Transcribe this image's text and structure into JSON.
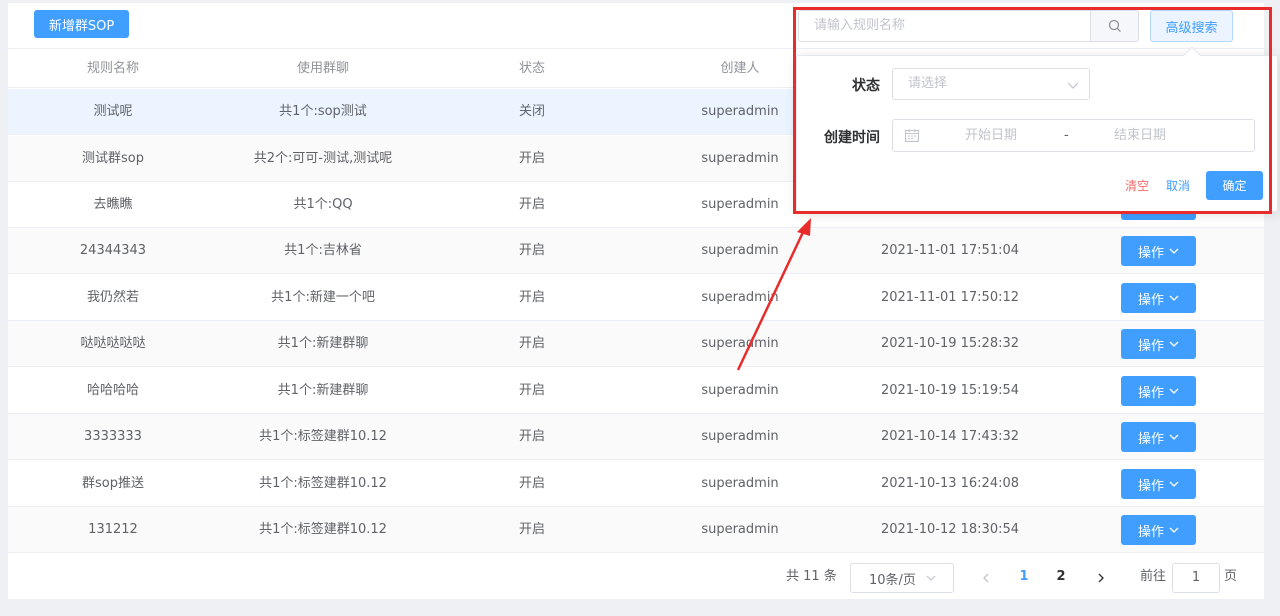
{
  "toolbar": {
    "add_label": "新增群SOP"
  },
  "search": {
    "placeholder": "请输入规则名称",
    "advanced_label": "高级搜索"
  },
  "filter": {
    "status_label": "状态",
    "status_placeholder": "请选择",
    "time_label": "创建时间",
    "start_placeholder": "开始日期",
    "range_separator": "-",
    "end_placeholder": "结束日期",
    "clear_label": "清空",
    "cancel_label": "取消",
    "confirm_label": "确定"
  },
  "table": {
    "headers": [
      "规则名称",
      "使用群聊",
      "状态",
      "创建人"
    ],
    "op_label": "操作",
    "rows": [
      {
        "name": "测试呢",
        "groups": "共1个:sop测试",
        "status": "关闭",
        "creator": "superadmin",
        "time": ""
      },
      {
        "name": "测试群sop",
        "groups": "共2个:可可-测试,测试呢",
        "status": "开启",
        "creator": "superadmin",
        "time": ""
      },
      {
        "name": "去瞧瞧",
        "groups": "共1个:QQ",
        "status": "开启",
        "creator": "superadmin",
        "time": ""
      },
      {
        "name": "24344343",
        "groups": "共1个:吉林省",
        "status": "开启",
        "creator": "superadmin",
        "time": "2021-11-01 17:51:04"
      },
      {
        "name": "我仍然若",
        "groups": "共1个:新建一个吧",
        "status": "开启",
        "creator": "superadmin",
        "time": "2021-11-01 17:50:12"
      },
      {
        "name": "哒哒哒哒哒",
        "groups": "共1个:新建群聊",
        "status": "开启",
        "creator": "superadmin",
        "time": "2021-10-19 15:28:32"
      },
      {
        "name": "哈哈哈哈",
        "groups": "共1个:新建群聊",
        "status": "开启",
        "creator": "superadmin",
        "time": "2021-10-19 15:19:54"
      },
      {
        "name": "3333333",
        "groups": "共1个:标签建群10.12",
        "status": "开启",
        "creator": "superadmin",
        "time": "2021-10-14 17:43:32"
      },
      {
        "name": "群sop推送",
        "groups": "共1个:标签建群10.12",
        "status": "开启",
        "creator": "superadmin",
        "time": "2021-10-13 16:24:08"
      },
      {
        "name": "131212",
        "groups": "共1个:标签建群10.12",
        "status": "开启",
        "creator": "superadmin",
        "time": "2021-10-12 18:30:54"
      }
    ]
  },
  "pagination": {
    "total": "共 11 条",
    "page_size": "10条/页",
    "pages": [
      "1",
      "2"
    ],
    "goto_label": "前往",
    "goto_value": "1",
    "page_suffix": "页"
  },
  "colors": {
    "primary": "#409eff",
    "danger": "#f56c6c",
    "annotation": "#e82c2c"
  }
}
